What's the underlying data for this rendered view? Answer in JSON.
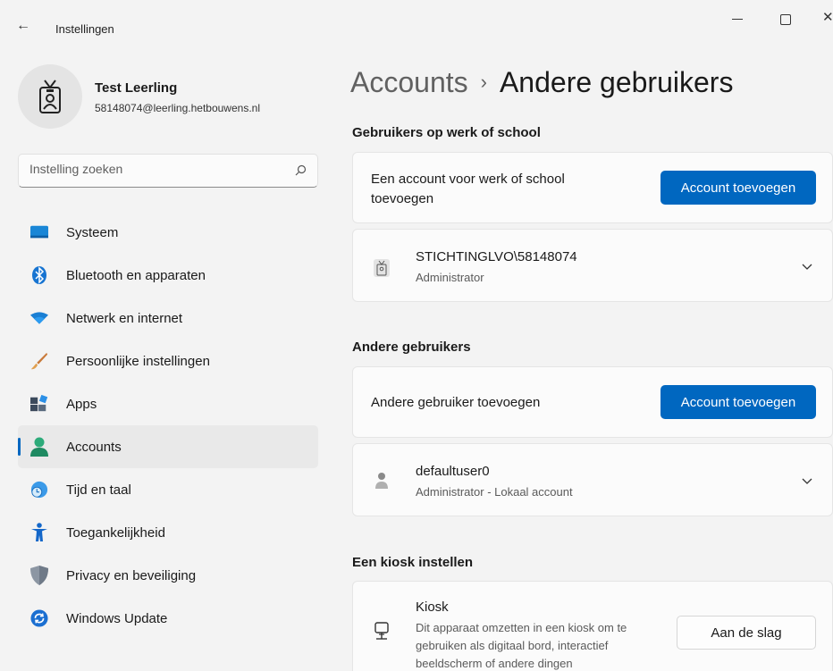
{
  "titlebar": {
    "back_icon": "arrow-left-icon",
    "title": "Instellingen",
    "minimize_icon": "minimize-icon",
    "maximize_icon": "maximize-icon",
    "close_icon": "close-icon"
  },
  "profile": {
    "name": "Test Leerling",
    "email": "58148074@leerling.hetbouwens.nl"
  },
  "search": {
    "placeholder": "Instelling zoeken"
  },
  "nav": {
    "items": [
      {
        "label": "Systeem",
        "icon": "monitor-icon"
      },
      {
        "label": "Bluetooth en apparaten",
        "icon": "bluetooth-icon"
      },
      {
        "label": "Netwerk en internet",
        "icon": "wifi-icon"
      },
      {
        "label": "Persoonlijke instellingen",
        "icon": "brush-icon"
      },
      {
        "label": "Apps",
        "icon": "apps-icon"
      },
      {
        "label": "Accounts",
        "icon": "person-icon",
        "active": true
      },
      {
        "label": "Tijd en taal",
        "icon": "globe-clock-icon"
      },
      {
        "label": "Toegankelijkheid",
        "icon": "accessibility-icon"
      },
      {
        "label": "Privacy en beveiliging",
        "icon": "shield-icon"
      },
      {
        "label": "Windows Update",
        "icon": "update-icon"
      }
    ]
  },
  "breadcrumb": {
    "parent": "Accounts",
    "separator": "›",
    "current": "Andere gebruikers"
  },
  "work_school": {
    "title": "Gebruikers op werk of school",
    "add_text": "Een account voor werk of school toevoegen",
    "add_button": "Account toevoegen",
    "user": {
      "name": "STICHTINGLVO\\58148074",
      "role": "Administrator"
    }
  },
  "other_users": {
    "title": "Andere gebruikers",
    "add_text": "Andere gebruiker toevoegen",
    "add_button": "Account toevoegen",
    "user": {
      "name": "defaultuser0",
      "role": "Administrator - Lokaal account"
    }
  },
  "kiosk": {
    "title": "Een kiosk instellen",
    "name": "Kiosk",
    "description": "Dit apparaat omzetten in een kiosk om te gebruiken als digitaal bord, interactief beeldscherm of andere dingen",
    "button": "Aan de slag"
  },
  "colors": {
    "accent": "#0067c0",
    "background": "#f3f3f3",
    "card": "#fbfbfb"
  }
}
